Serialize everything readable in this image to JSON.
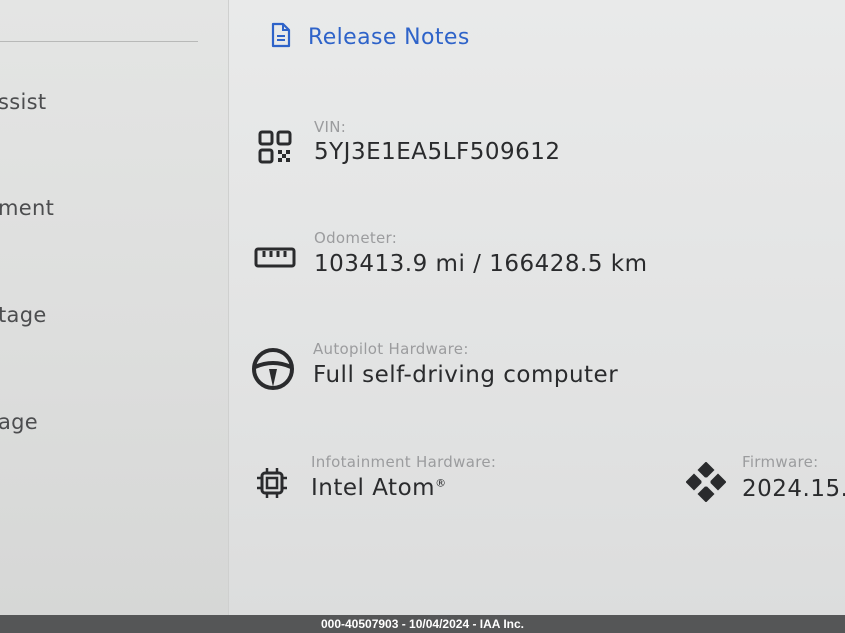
{
  "sidebar": {
    "items": [
      {
        "label": "ssist"
      },
      {
        "label": "ment"
      },
      {
        "label": "tage"
      },
      {
        "label": "age"
      }
    ]
  },
  "release_notes": {
    "label": "Release Notes",
    "icon": "document-icon"
  },
  "fields": {
    "vin": {
      "label": "VIN:",
      "value": "5YJ3E1EA5LF509612",
      "icon": "qr-code-icon"
    },
    "odometer": {
      "label": "Odometer:",
      "value": "103413.9 mi / 166428.5 km",
      "icon": "ruler-icon"
    },
    "autopilot": {
      "label": "Autopilot Hardware:",
      "value": "Full self-driving computer",
      "icon": "steering-wheel-icon"
    },
    "infotainment": {
      "label": "Infotainment Hardware:",
      "value": "Intel Atom",
      "value_suffix": "®",
      "icon": "chip-icon"
    },
    "firmware": {
      "label": "Firmware:",
      "value": "2024.15.",
      "icon": "firmware-icon"
    }
  },
  "footer": {
    "text": "000-40507903 - 10/04/2024 - IAA Inc."
  },
  "colors": {
    "link": "#2e63c9",
    "label": "#9b9c9e",
    "value": "#2a2b2d"
  }
}
